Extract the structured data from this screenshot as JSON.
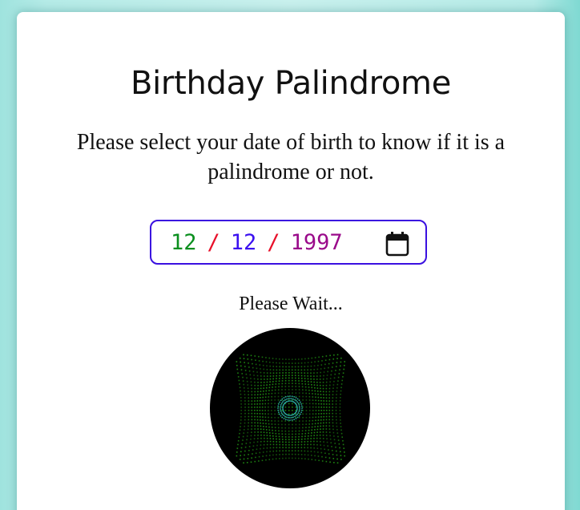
{
  "title": "Birthday Palindrome",
  "subtitle": "Please select your date of birth to know if it is a palindrome or not.",
  "date_input": {
    "month": "12",
    "day": "12",
    "year": "1997",
    "separator": "/",
    "colors": {
      "month": "#0a8f1e",
      "day": "#3b10f0",
      "year": "#9a0a8a",
      "separator": "#e8102a",
      "border": "#3a10e0"
    },
    "icon": "calendar-icon"
  },
  "status_text": "Please Wait...",
  "loader": {
    "icon": "loading-spinner",
    "colors": {
      "background": "#000000",
      "grid": "#1f8a12",
      "center": "#2aa7a0"
    }
  }
}
